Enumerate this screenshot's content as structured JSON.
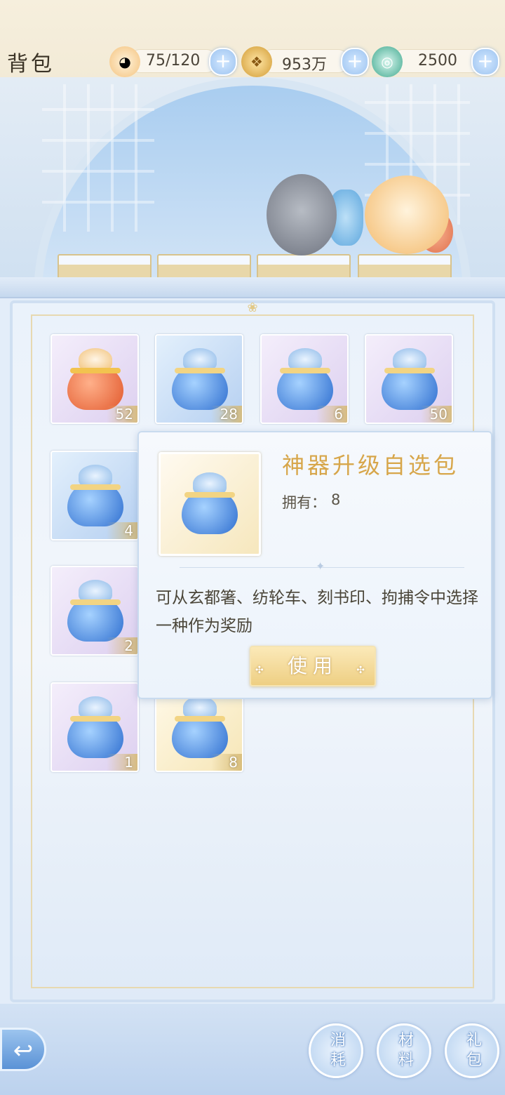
{
  "header": {
    "title": "背包",
    "resources": [
      {
        "icon": "stamina-cat-icon",
        "value": "75/120"
      },
      {
        "icon": "coin-paw-icon",
        "value": "953万"
      },
      {
        "icon": "jade-dragon-icon",
        "value": "2500"
      }
    ],
    "add_symbol": "+"
  },
  "items": [
    {
      "type": "red-pouch",
      "quantity": "52"
    },
    {
      "type": "blue-pouch",
      "quantity": "28"
    },
    {
      "type": "blue-pouch",
      "quantity": "6"
    },
    {
      "type": "blue-pouch",
      "quantity": "50"
    },
    {
      "type": "blue-pouch",
      "quantity": "4"
    },
    {
      "type": "blue-pouch",
      "quantity": "2"
    },
    {
      "type": "blue-pouch",
      "quantity": "1"
    },
    {
      "type": "blue-pouch",
      "quantity": "8"
    }
  ],
  "popup": {
    "name": "神器升级自选包",
    "owned_label": "拥有：",
    "owned_value": "8",
    "description": "可从玄都箸、纺轮车、刻书印、拘捕令中选择一种作为奖励",
    "use_button": "使用"
  },
  "bottom_tabs": [
    {
      "label": "消耗"
    },
    {
      "label": "材料"
    },
    {
      "label": "礼包"
    }
  ],
  "colors": {
    "title_gold": "#d7a64a",
    "accent_blue": "#5a92d6"
  }
}
